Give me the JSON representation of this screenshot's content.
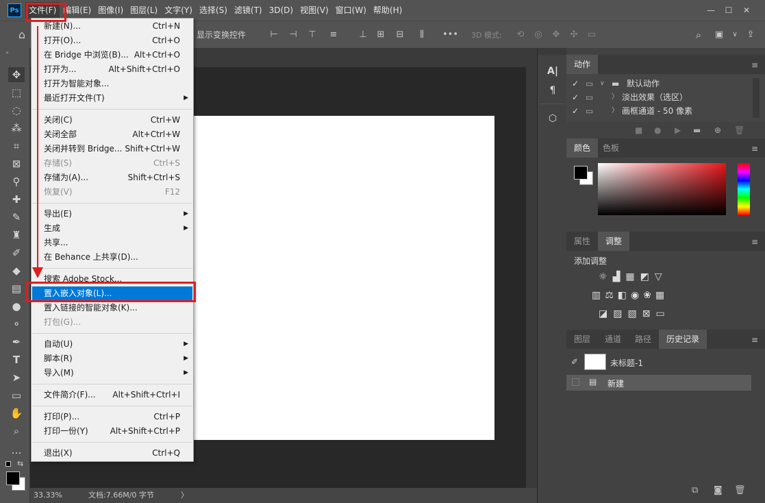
{
  "app": {
    "logo": "Ps"
  },
  "menubar": {
    "items": [
      {
        "label": "文件(F)"
      },
      {
        "label": "编辑(E)"
      },
      {
        "label": "图像(I)"
      },
      {
        "label": "图层(L)"
      },
      {
        "label": "文字(Y)"
      },
      {
        "label": "选择(S)"
      },
      {
        "label": "滤镜(T)"
      },
      {
        "label": "3D(D)"
      },
      {
        "label": "视图(V)"
      },
      {
        "label": "窗口(W)"
      },
      {
        "label": "帮助(H)"
      }
    ],
    "window_controls": [
      "—",
      "☐",
      "✕"
    ]
  },
  "optionsbar": {
    "show_transform": "显示变换控件",
    "mode_3d": "3D 模式:",
    "more": "•••"
  },
  "file_menu": {
    "groups": [
      [
        {
          "label": "新建(N)...",
          "shortcut": "Ctrl+N"
        },
        {
          "label": "打开(O)...",
          "shortcut": "Ctrl+O"
        },
        {
          "label": "在 Bridge 中浏览(B)...",
          "shortcut": "Alt+Ctrl+O"
        },
        {
          "label": "打开为...",
          "shortcut": "Alt+Shift+Ctrl+O"
        },
        {
          "label": "打开为智能对象...",
          "shortcut": ""
        },
        {
          "label": "最近打开文件(T)",
          "shortcut": "",
          "submenu": true
        }
      ],
      [
        {
          "label": "关闭(C)",
          "shortcut": "Ctrl+W"
        },
        {
          "label": "关闭全部",
          "shortcut": "Alt+Ctrl+W"
        },
        {
          "label": "关闭并转到 Bridge...",
          "shortcut": "Shift+Ctrl+W"
        },
        {
          "label": "存储(S)",
          "shortcut": "Ctrl+S",
          "disabled": true
        },
        {
          "label": "存储为(A)...",
          "shortcut": "Shift+Ctrl+S"
        },
        {
          "label": "恢复(V)",
          "shortcut": "F12",
          "disabled": true
        }
      ],
      [
        {
          "label": "导出(E)",
          "shortcut": "",
          "submenu": true
        },
        {
          "label": "生成",
          "shortcut": "",
          "submenu": true
        },
        {
          "label": "共享...",
          "shortcut": ""
        },
        {
          "label": "在 Behance 上共享(D)...",
          "shortcut": ""
        }
      ],
      [
        {
          "label": "搜索 Adobe Stock...",
          "shortcut": ""
        },
        {
          "label": "置入嵌入对象(L)...",
          "shortcut": "",
          "highlighted": true
        },
        {
          "label": "置入链接的智能对象(K)...",
          "shortcut": ""
        },
        {
          "label": "打包(G)...",
          "shortcut": "",
          "disabled": true
        }
      ],
      [
        {
          "label": "自动(U)",
          "shortcut": "",
          "submenu": true
        },
        {
          "label": "脚本(R)",
          "shortcut": "",
          "submenu": true
        },
        {
          "label": "导入(M)",
          "shortcut": "",
          "submenu": true
        }
      ],
      [
        {
          "label": "文件简介(F)...",
          "shortcut": "Alt+Shift+Ctrl+I"
        }
      ],
      [
        {
          "label": "打印(P)...",
          "shortcut": "Ctrl+P"
        },
        {
          "label": "打印一份(Y)",
          "shortcut": "Alt+Shift+Ctrl+P"
        }
      ],
      [
        {
          "label": "退出(X)",
          "shortcut": "Ctrl+Q"
        }
      ]
    ]
  },
  "statusbar": {
    "zoom": "33.33%",
    "doc_info": "文档:7.66M/0 字节",
    "arrow": "〉"
  },
  "actions_panel": {
    "tab": "动作",
    "rows": [
      {
        "label": "默认动作"
      },
      {
        "label": "淡出效果（选区）"
      },
      {
        "label": "画框通道 - 50 像素"
      }
    ]
  },
  "color_panel": {
    "tabs": [
      "颜色",
      "色板"
    ]
  },
  "adjust_panel": {
    "tabs": [
      "属性",
      "调整"
    ],
    "title": "添加调整"
  },
  "layers_panel": {
    "tabs": [
      "图层",
      "通道",
      "路径",
      "历史记录"
    ],
    "snapshot": "未标题-1",
    "history_item": "新建"
  },
  "colors": {
    "highlight": "#0078d7",
    "annotation": "#e21d1d",
    "panel_bg": "#424242"
  }
}
